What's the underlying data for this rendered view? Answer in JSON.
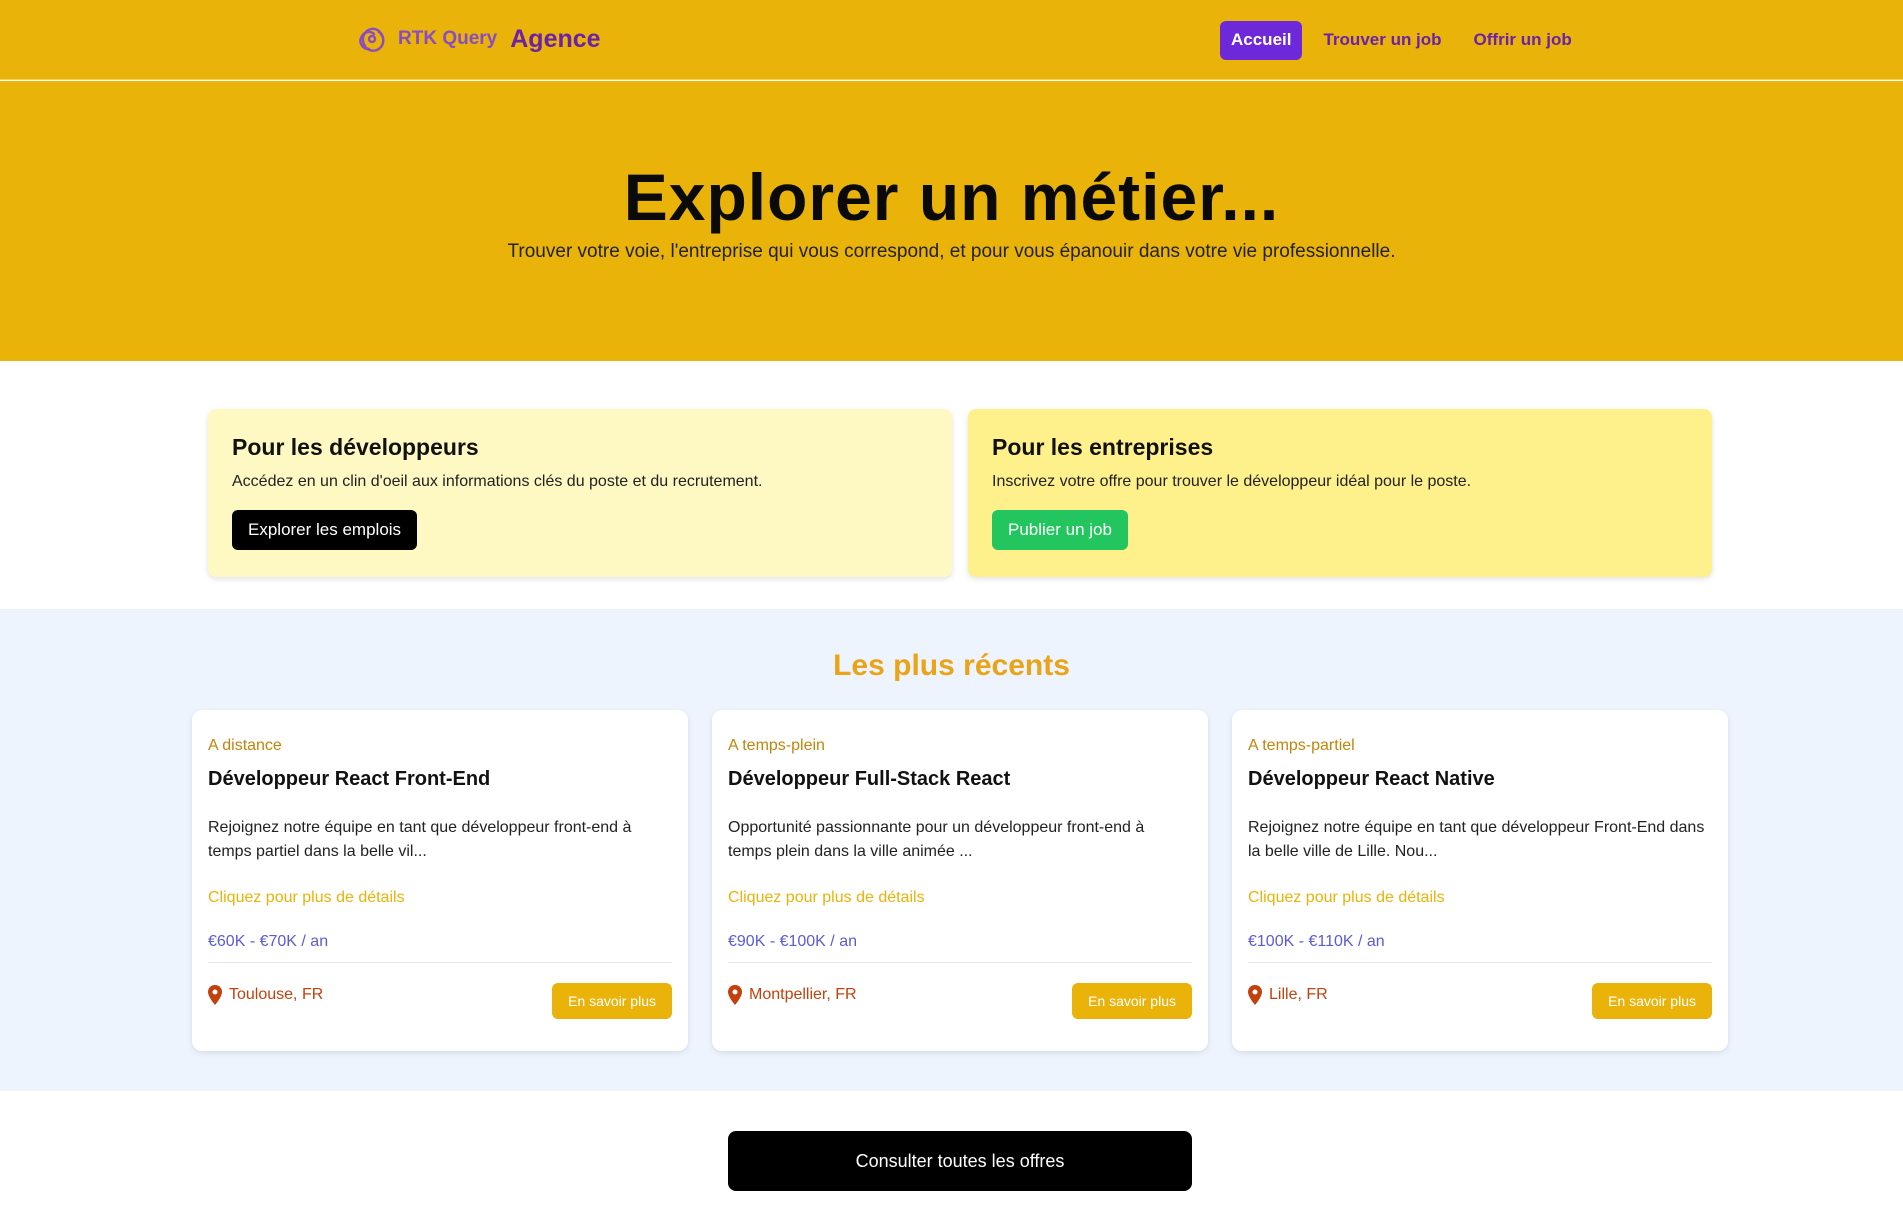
{
  "nav": {
    "brand_rtk": "RTK Query",
    "brand_agence": "Agence",
    "links": [
      "Accueil",
      "Trouver un job",
      "Offrir un job"
    ]
  },
  "hero": {
    "title": "Explorer un métier...",
    "subtitle": "Trouver votre voie, l'entreprise qui vous correspond, et pour vous épanouir dans votre vie professionnelle."
  },
  "intro": {
    "dev": {
      "title": "Pour les développeurs",
      "desc": "Accédez en un clin d'oeil aux informations clés du poste et du recrutement.",
      "button": "Explorer les emplois"
    },
    "ent": {
      "title": "Pour les entreprises",
      "desc": "Inscrivez votre offre pour trouver le développeur idéal pour le poste.",
      "button": "Publier un job"
    }
  },
  "recent": {
    "title": "Les plus récents",
    "jobs": [
      {
        "type": "A distance",
        "title": "Développeur React Front-End",
        "desc": "Rejoignez notre équipe en tant que développeur front-end à temps partiel dans la belle vil...",
        "link": "Cliquez pour plus de détails",
        "salary": "€60K - €70K / an",
        "location": "Toulouse, FR",
        "button": "En savoir plus"
      },
      {
        "type": "A temps-plein",
        "title": "Développeur Full-Stack React",
        "desc": "Opportunité passionnante pour un développeur front-end à temps plein dans la ville animée ...",
        "link": "Cliquez pour plus de détails",
        "salary": "€90K - €100K / an",
        "location": "Montpellier, FR",
        "button": "En savoir plus"
      },
      {
        "type": "A temps-partiel",
        "title": "Développeur React Native",
        "desc": "Rejoignez notre équipe en tant que développeur Front-End dans la belle ville de Lille. Nou...",
        "link": "Cliquez pour plus de détails",
        "salary": "€100K - €110K / an",
        "location": "Lille, FR",
        "button": "En savoir plus"
      }
    ]
  },
  "footer_button": "Consulter toutes les offres",
  "colors": {
    "primary_yellow": "#e9b30a",
    "purple": "#6d28d9",
    "green": "#22c55e",
    "location_red": "#c2410c"
  }
}
